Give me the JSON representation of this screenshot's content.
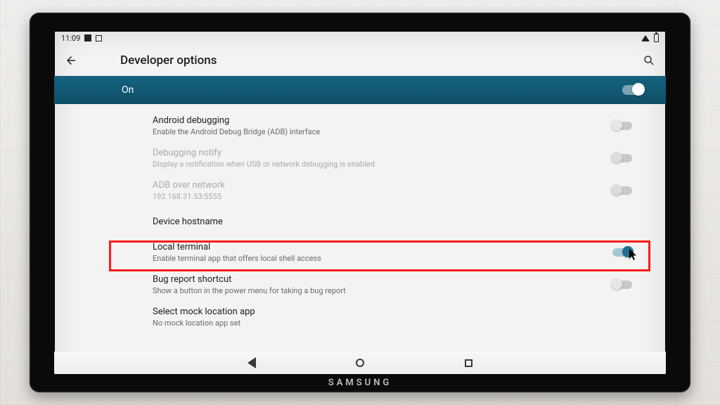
{
  "status": {
    "time": "11:09"
  },
  "appbar": {
    "title": "Developer options"
  },
  "master": {
    "label": "On"
  },
  "items": {
    "android_debugging": {
      "title": "Android debugging",
      "sub": "Enable the Android Debug Bridge (ADB) interface"
    },
    "debugging_notify": {
      "title": "Debugging notify",
      "sub": "Display a notification when USB or network debugging is enabled"
    },
    "adb_over_network": {
      "title": "ADB over network",
      "sub": "192.168.31.53:5555"
    },
    "device_hostname": {
      "title": "Device hostname"
    },
    "local_terminal": {
      "title": "Local terminal",
      "sub": "Enable terminal app that offers local shell access"
    },
    "bug_report_shortcut": {
      "title": "Bug report shortcut",
      "sub": "Show a button in the power menu for taking a bug report"
    },
    "select_mock_location": {
      "title": "Select mock location app",
      "sub": "No mock location app set"
    }
  },
  "brand": "SAMSUNG"
}
